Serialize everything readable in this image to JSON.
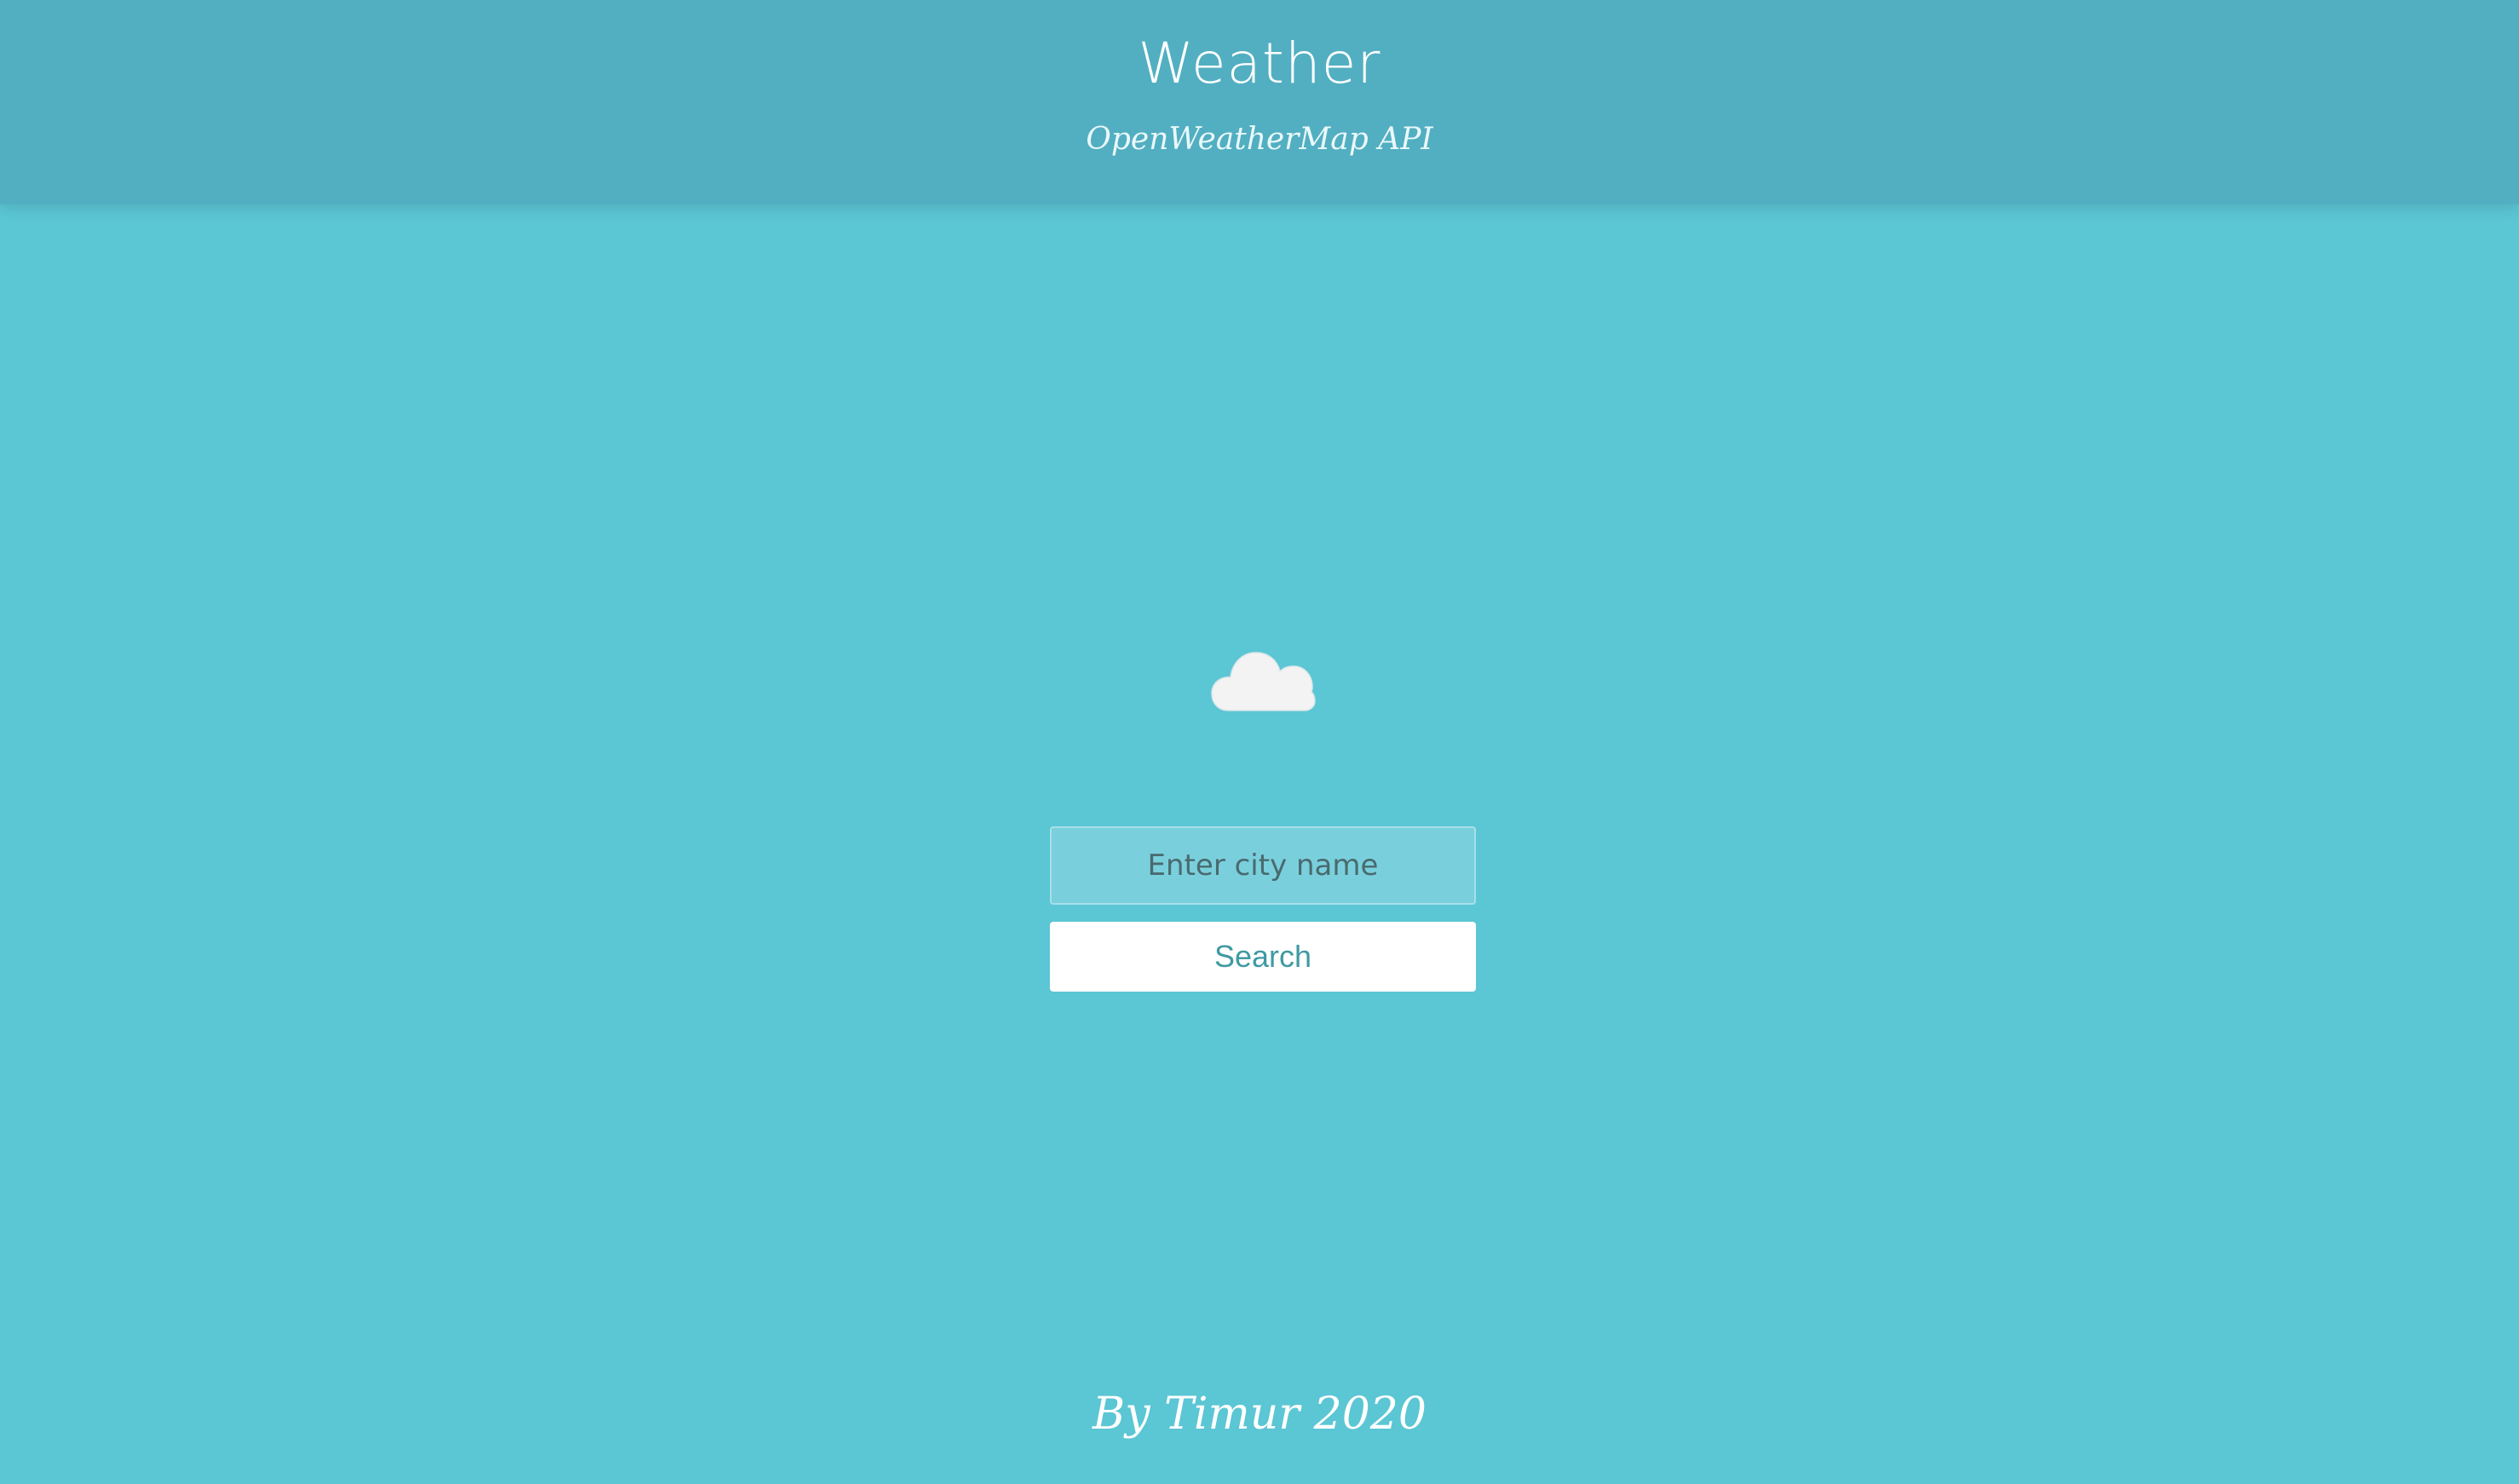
{
  "header": {
    "title": "Weather",
    "subtitle": "OpenWeatherMap API",
    "background_color": "#52afc1"
  },
  "main": {
    "weather_icon": "cloud-icon",
    "background_color": "#5bc6d4"
  },
  "search": {
    "placeholder": "Enter city name",
    "value": "",
    "button_label": "Search"
  },
  "footer": {
    "text": "By Timur 2020"
  }
}
